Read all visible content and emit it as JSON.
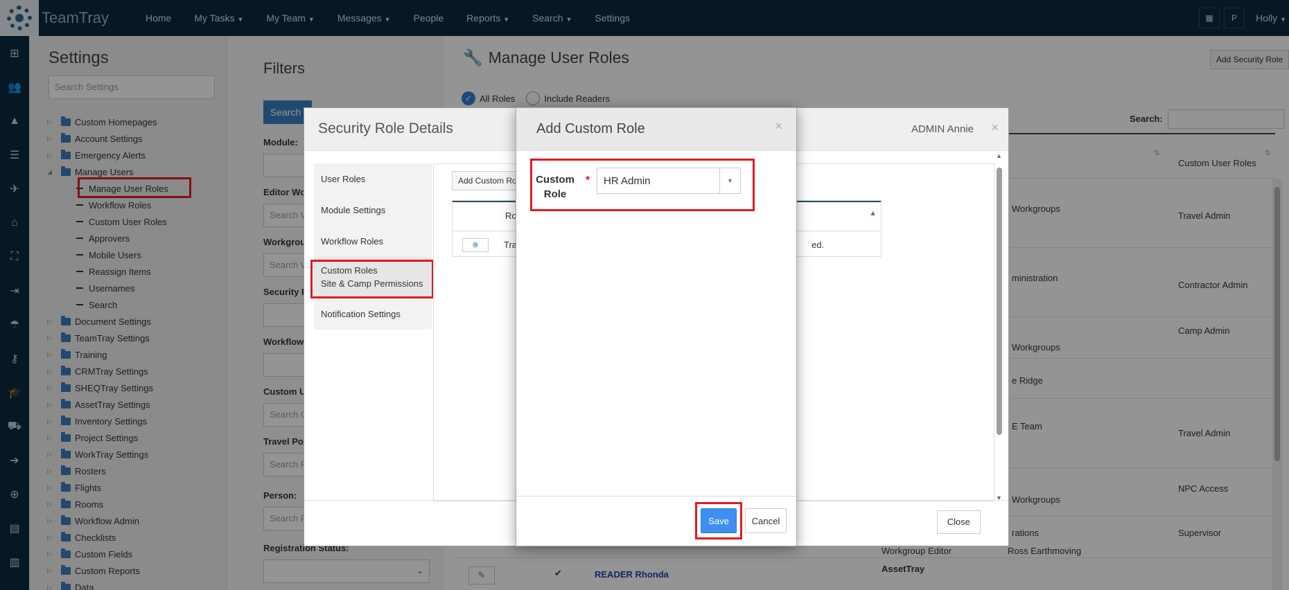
{
  "app": {
    "brand": "TeamTray"
  },
  "nav": {
    "items": [
      {
        "label": "Home",
        "caret": false
      },
      {
        "label": "My Tasks",
        "caret": true
      },
      {
        "label": "My Team",
        "caret": true
      },
      {
        "label": "Messages",
        "caret": true
      },
      {
        "label": "People",
        "caret": false
      },
      {
        "label": "Reports",
        "caret": true
      },
      {
        "label": "Search",
        "caret": true
      },
      {
        "label": "Settings",
        "caret": false
      }
    ],
    "profile_initial": "P",
    "user": "Holly"
  },
  "settings": {
    "title": "Settings",
    "search_placeholder": "Search Settings",
    "tree": [
      {
        "label": "Custom Homepages",
        "type": "folder"
      },
      {
        "label": "Account Settings",
        "type": "folder"
      },
      {
        "label": "Emergency Alerts",
        "type": "folder"
      },
      {
        "label": "Manage Users",
        "type": "folder",
        "expanded": true
      },
      {
        "label": "Manage User Roles",
        "type": "child",
        "selected": true
      },
      {
        "label": "Workflow Roles",
        "type": "child"
      },
      {
        "label": "Custom User Roles",
        "type": "child"
      },
      {
        "label": "Approvers",
        "type": "child"
      },
      {
        "label": "Mobile Users",
        "type": "child"
      },
      {
        "label": "Reassign Items",
        "type": "child"
      },
      {
        "label": "Usernames",
        "type": "child"
      },
      {
        "label": "Search",
        "type": "child"
      },
      {
        "label": "Document Settings",
        "type": "folder"
      },
      {
        "label": "TeamTray Settings",
        "type": "folder"
      },
      {
        "label": "Training",
        "type": "folder"
      },
      {
        "label": "CRMTray Settings",
        "type": "folder"
      },
      {
        "label": "SHEQTray Settings",
        "type": "folder"
      },
      {
        "label": "AssetTray Settings",
        "type": "folder"
      },
      {
        "label": "Inventory Settings",
        "type": "folder"
      },
      {
        "label": "Project Settings",
        "type": "folder"
      },
      {
        "label": "WorkTray Settings",
        "type": "folder"
      },
      {
        "label": "Rosters",
        "type": "folder"
      },
      {
        "label": "Flights",
        "type": "folder"
      },
      {
        "label": "Rooms",
        "type": "folder"
      },
      {
        "label": "Workflow Admin",
        "type": "folder"
      },
      {
        "label": "Checklists",
        "type": "folder"
      },
      {
        "label": "Custom Fields",
        "type": "folder"
      },
      {
        "label": "Custom Reports",
        "type": "folder"
      },
      {
        "label": "Data",
        "type": "folder"
      }
    ]
  },
  "filters": {
    "title": "Filters",
    "search_button": "Search",
    "fields": [
      {
        "label": "Module:",
        "placeholder": ""
      },
      {
        "label": "Editor Wo",
        "placeholder": "Search W"
      },
      {
        "label": "Workgrou",
        "placeholder": "Search W"
      },
      {
        "label": "Security R",
        "placeholder": ""
      },
      {
        "label": "Workflow",
        "placeholder": ""
      },
      {
        "label": "Custom U",
        "placeholder": "Search C"
      },
      {
        "label": "Travel Po",
        "placeholder": "Search F"
      },
      {
        "label": "Person:",
        "placeholder": "Search F"
      }
    ],
    "registration_label": "Registration Status:"
  },
  "main": {
    "title": "Manage User Roles",
    "add_security_button": "Add Security Role",
    "radio_all": "All Roles",
    "radio_readers": "Include Readers",
    "search_label": "Search:",
    "column_custom_roles": "Custom User Roles",
    "rows": [
      {
        "middle": "Workgroups",
        "custom": "Travel Admin"
      },
      {
        "middle": "ministration",
        "custom": "Contractor Admin"
      },
      {
        "middle": "Workgroups",
        "custom": "Camp Admin"
      },
      {
        "middle": "e Ridge",
        "custom": ""
      },
      {
        "middle": "E Team",
        "custom": "Travel Admin"
      },
      {
        "middle": "Workgroups",
        "custom": "NPC Access"
      },
      {
        "middle": "rations",
        "custom": "Supervisor"
      }
    ],
    "lower_rows": [
      {
        "a": "Workgroup Editor",
        "b": "Ross Earthmoving"
      }
    ],
    "last_row": {
      "name": "READER Rhonda",
      "module": "AssetTray"
    }
  },
  "srd": {
    "title": "Security Role Details",
    "user": "ADMIN Annie",
    "tabs": [
      {
        "label": "User Roles"
      },
      {
        "label": "Module Settings"
      },
      {
        "label": "Workflow Roles"
      },
      {
        "label": "Custom Roles",
        "sub": "Site & Camp Permissions",
        "active": true
      },
      {
        "label": "Notification Settings"
      }
    ],
    "add_button": "Add Custom Role",
    "table_col": "Ro",
    "row_text_left": "Tra",
    "row_text_right": "ed.",
    "close_button": "Close"
  },
  "acr": {
    "title": "Add Custom Role",
    "label_line1": "Custom",
    "label_line2": "Role",
    "required_mark": "*",
    "selected_value": "HR Admin",
    "save_button": "Save",
    "cancel_button": "Cancel"
  },
  "colors": {
    "nav_bg": "#0b2a3d",
    "highlight": "#e01a22",
    "primary": "#3d8ff0"
  }
}
